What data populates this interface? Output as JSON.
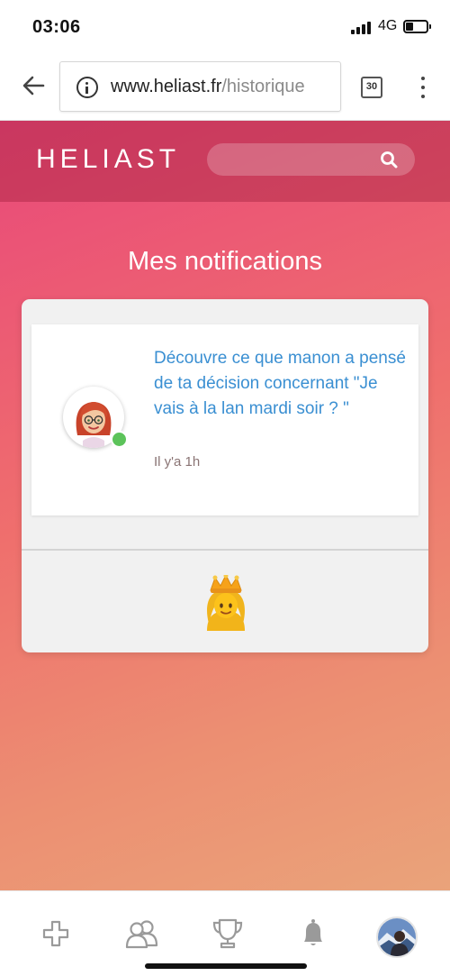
{
  "status_bar": {
    "time": "03:06",
    "network": "4G",
    "battery_level": 0.35,
    "icons": [
      "signal-icon",
      "battery-icon"
    ]
  },
  "browser": {
    "url_host": "www.heliast.fr",
    "url_path": "/historique",
    "tab_count": "30",
    "icons": [
      "back-arrow-icon",
      "info-icon",
      "tabs-icon",
      "more-vertical-icon"
    ]
  },
  "header": {
    "logo_text": "HELIAST",
    "search_placeholder": "",
    "icons": [
      "search-icon"
    ]
  },
  "main": {
    "title": "Mes notifications",
    "notifications": [
      {
        "text": "Découvre ce que manon a pensé de ta décision concernant \"Je vais à la lan mardi soir ? \"",
        "time": "Il y'a 1h",
        "avatar": "user-avatar-manon",
        "online": true
      }
    ],
    "footer_icon": "princess-emoji-icon"
  },
  "bottom_nav": {
    "items": [
      "add-icon",
      "friends-icon",
      "trophy-icon",
      "bell-icon",
      "profile-avatar"
    ]
  },
  "colors": {
    "gradient_start": "#e9487a",
    "gradient_end": "#eaa37a",
    "link_blue": "#3a8fd2",
    "online_green": "#5cc35a"
  }
}
